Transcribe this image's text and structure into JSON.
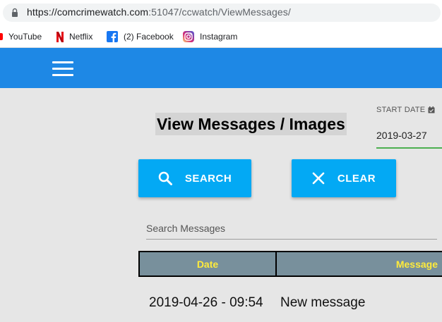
{
  "browser": {
    "url_host": "https://comcrimewatch.com",
    "url_rest": ":51047/ccwatch/ViewMessages/",
    "bookmarks": [
      {
        "label": "YouTube",
        "icon": "youtube-icon"
      },
      {
        "label": "Netflix",
        "icon": "netflix-icon"
      },
      {
        "label": "(2) Facebook",
        "icon": "facebook-icon"
      },
      {
        "label": "Instagram",
        "icon": "instagram-icon"
      }
    ]
  },
  "header": {
    "menu_icon": "hamburger-menu-icon",
    "color": "#1e88e5"
  },
  "main": {
    "title": "View Messages / Images",
    "start_date": {
      "label": "START DATE",
      "value": "2019-03-27"
    },
    "search_button": {
      "label": "SEARCH",
      "icon": "search-icon"
    },
    "clear_button": {
      "label": "CLEAR",
      "icon": "close-icon"
    },
    "search_field": {
      "placeholder": "Search Messages",
      "value": ""
    },
    "table": {
      "headers": {
        "date": "Date",
        "message": "Message"
      },
      "rows": [
        {
          "date": "2019-04-26 - 09:54",
          "message": "New message"
        }
      ]
    }
  },
  "colors": {
    "accent": "#03a9f4",
    "table_header_bg": "#78909c",
    "table_header_text": "#ffeb3b",
    "date_underline": "#4caf50"
  }
}
